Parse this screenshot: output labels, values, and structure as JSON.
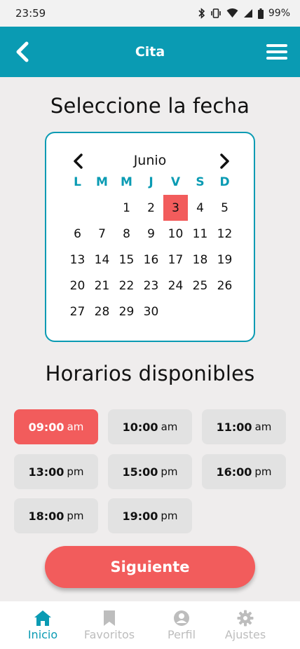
{
  "status_bar": {
    "time": "23:59",
    "battery": "99%"
  },
  "header": {
    "title": "Cita"
  },
  "date_section": {
    "title": "Seleccione la fecha"
  },
  "calendar": {
    "month": "Junio",
    "weekdays": [
      "L",
      "M",
      "M",
      "J",
      "V",
      "S",
      "D"
    ],
    "days": [
      "",
      "",
      "1",
      "2",
      "3",
      "4",
      "5",
      "6",
      "7",
      "8",
      "9",
      "10",
      "11",
      "12",
      "13",
      "14",
      "15",
      "16",
      "17",
      "18",
      "19",
      "20",
      "21",
      "22",
      "23",
      "24",
      "25",
      "26",
      "27",
      "28",
      "29",
      "30"
    ],
    "selected_day": "3"
  },
  "slots_section": {
    "title": "Horarios disponibles"
  },
  "slots": [
    {
      "time": "09:00",
      "period": "am",
      "selected": true
    },
    {
      "time": "10:00",
      "period": "am",
      "selected": false
    },
    {
      "time": "11:00",
      "period": "am",
      "selected": false
    },
    {
      "time": "13:00",
      "period": "pm",
      "selected": false
    },
    {
      "time": "15:00",
      "period": "pm",
      "selected": false
    },
    {
      "time": "16:00",
      "period": "pm",
      "selected": false
    },
    {
      "time": "18:00",
      "period": "pm",
      "selected": false
    },
    {
      "time": "19:00",
      "period": "pm",
      "selected": false
    }
  ],
  "next_button": {
    "label": "Siguiente"
  },
  "nav": [
    {
      "label": "Inicio",
      "icon": "home-icon",
      "active": true
    },
    {
      "label": "Favoritos",
      "icon": "bookmark-icon",
      "active": false
    },
    {
      "label": "Perfil",
      "icon": "user-icon",
      "active": false
    },
    {
      "label": "Ajustes",
      "icon": "gear-icon",
      "active": false
    }
  ],
  "colors": {
    "primary": "#0a9bb3",
    "accent": "#f25c5c",
    "background": "#efeded"
  }
}
